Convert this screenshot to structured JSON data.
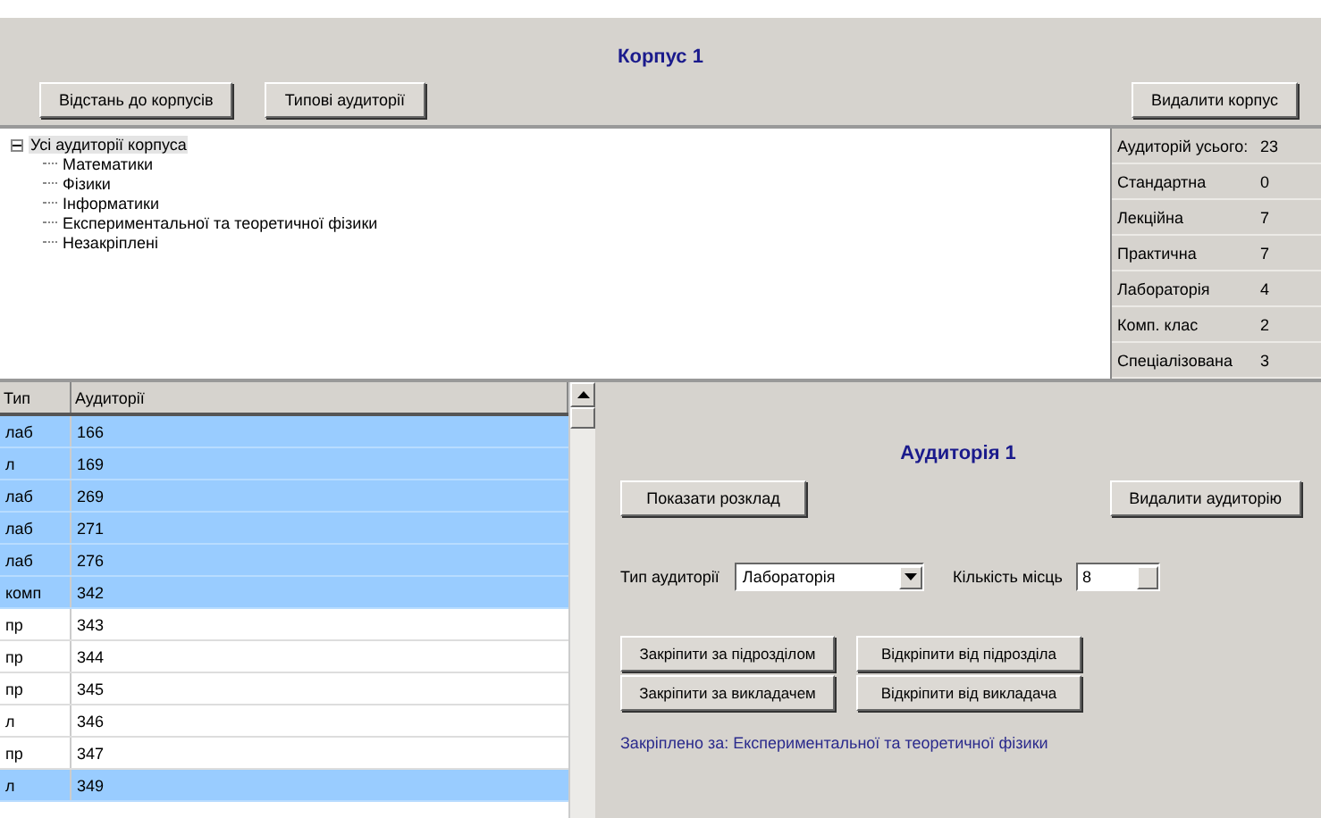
{
  "header": {
    "title": "Корпус 1",
    "buttons": [
      "Відстань до корпусів",
      "Типові аудиторії"
    ],
    "delete_button": "Видалити корпус"
  },
  "tree": {
    "label": "Усі аудиторії корпуса",
    "expanded": true,
    "selected": true,
    "children": [
      {
        "label": "Математики",
        "selected": false
      },
      {
        "label": "Фізики",
        "selected": false
      },
      {
        "label": "Інформатики",
        "selected": false
      },
      {
        "label": "Експериментальної та теоретичної фізики",
        "selected": false
      },
      {
        "label": "Незакріплені",
        "selected": false
      }
    ]
  },
  "stats": [
    {
      "label": "Аудиторій усього:",
      "value": "23"
    },
    {
      "label": "Стандартна",
      "value": "0"
    },
    {
      "label": "Лекційна",
      "value": "7"
    },
    {
      "label": "Практична",
      "value": "7"
    },
    {
      "label": "Лабораторія",
      "value": "4"
    },
    {
      "label": "Комп. клас",
      "value": "2"
    },
    {
      "label": "Спеціалізована",
      "value": "3"
    }
  ],
  "table": {
    "columns": [
      "Тип",
      "Аудиторії"
    ],
    "rows": [
      {
        "type": "лаб",
        "room": "166",
        "selected": true
      },
      {
        "type": "л",
        "room": "169",
        "selected": true
      },
      {
        "type": "лаб",
        "room": "269",
        "selected": true
      },
      {
        "type": "лаб",
        "room": "271",
        "selected": true
      },
      {
        "type": "лаб",
        "room": "276",
        "selected": true
      },
      {
        "type": "комп",
        "room": "342",
        "selected": true
      },
      {
        "type": "пр",
        "room": "343",
        "selected": false
      },
      {
        "type": "пр",
        "room": "344",
        "selected": false
      },
      {
        "type": "пр",
        "room": "345",
        "selected": false
      },
      {
        "type": "л",
        "room": "346",
        "selected": false
      },
      {
        "type": "пр",
        "room": "347",
        "selected": false
      },
      {
        "type": "л",
        "room": "349",
        "selected": true
      }
    ]
  },
  "room_panel": {
    "title": "Аудиторія 1",
    "schedule_button": "Показати розклад",
    "delete_button": "Видалити аудиторію",
    "type_label": "Тип аудиторії",
    "type_value": "Лабораторія",
    "seats_label": "Кількість місць",
    "seats_value": "8",
    "assign_buttons": [
      "Закріпити за підрозділом",
      "Відкріпити від підрозділа",
      "Закріпити за викладачем",
      "Відкріпити від викладача"
    ],
    "assigned_text": "Закріплено за: Експериментальної та теоретичної фізики"
  }
}
